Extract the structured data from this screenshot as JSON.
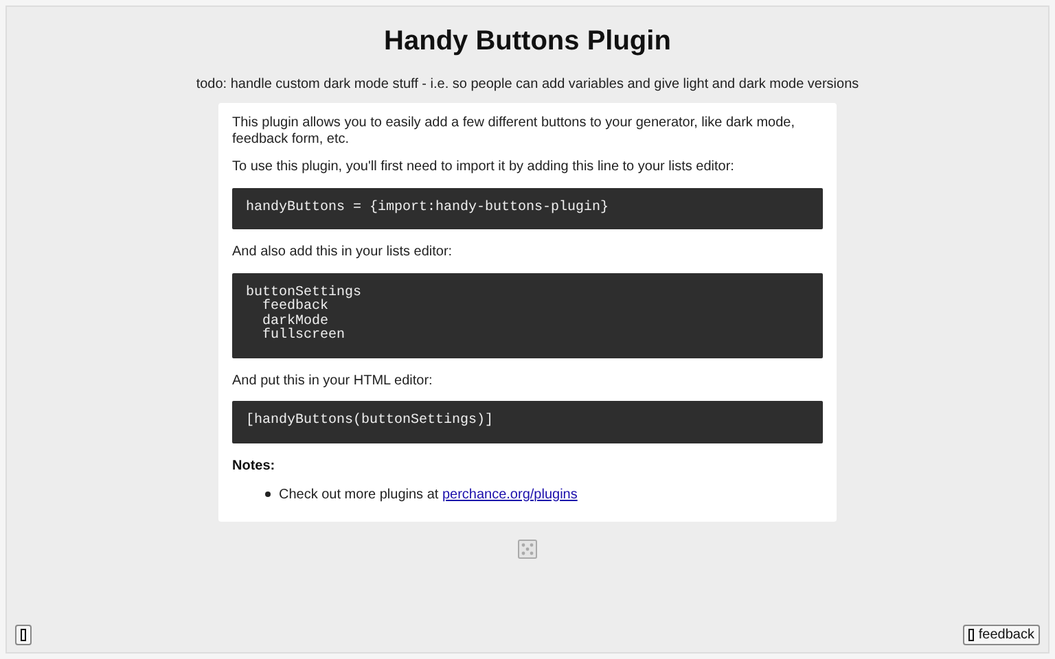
{
  "title": "Handy Buttons Plugin",
  "subtitle": "todo: handle custom dark mode stuff - i.e. so people can add variables and give light and dark mode versions",
  "content": [
    {
      "kind": "text",
      "text": "This plugin allows you to easily add a few different buttons to your generator, like dark mode, feedback form, etc."
    },
    {
      "kind": "text",
      "text": "To use this plugin, you'll first need to import it by adding this line to your lists editor:"
    },
    {
      "kind": "code",
      "text": "handyButtons = {import:handy-buttons-plugin}"
    },
    {
      "kind": "text",
      "text": "And also add this in your lists editor:"
    },
    {
      "kind": "code",
      "text": "buttonSettings\n  feedback\n  darkMode\n  fullscreen"
    },
    {
      "kind": "text",
      "text": "And put this in your HTML editor:"
    },
    {
      "kind": "code",
      "text": "[handyButtons(buttonSettings)]"
    },
    {
      "kind": "heading",
      "text": "Notes:"
    },
    {
      "kind": "bullet",
      "text": "Check out more plugins at ",
      "link": "perchance.org/plugins"
    }
  ],
  "footer": {
    "feedback_button": "feedback"
  }
}
